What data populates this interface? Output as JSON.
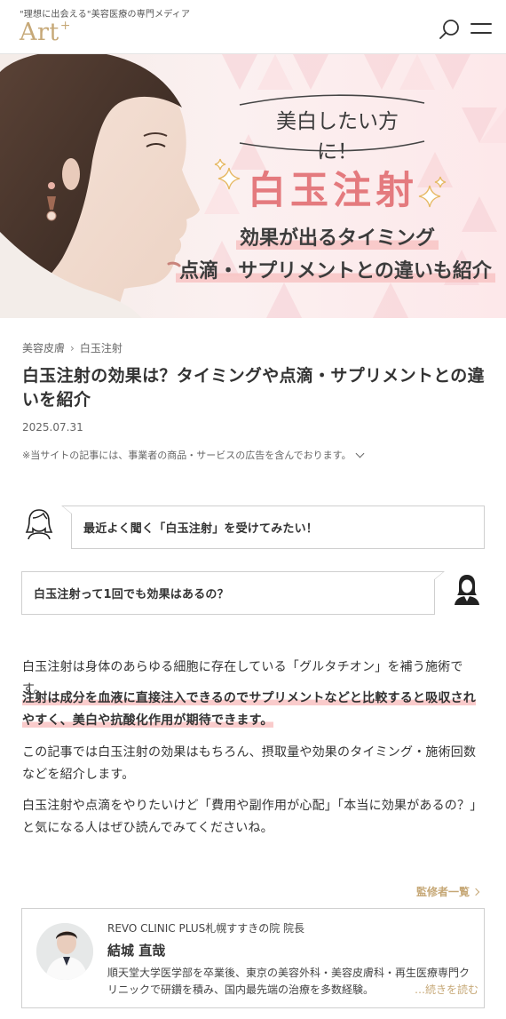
{
  "header": {
    "tagline": "\"理想に出会える\"美容医療の専門メディア",
    "logo": "Art",
    "logo_sup": "+",
    "icons": {
      "search": "search-icon",
      "menu": "hamburger-menu-icon"
    }
  },
  "hero": {
    "sub_heading": "美白したい方に！",
    "main_heading": "白玉注射",
    "line1": "効果が出るタイミング",
    "line2": "点滴・サプリメントとの違いも紹介"
  },
  "breadcrumb": {
    "category": "美容皮膚",
    "current": "白玉注射",
    "separator_icon": "chevron-right-icon"
  },
  "article": {
    "title": "白玉注射の効果は？タイミングや点滴・サプリメントとの違いを紹介",
    "date": "2025.07.31",
    "ad_note": "※当サイトの記事には、事業者の商品・サービスの広告を含んでおります。"
  },
  "dialogue": [
    {
      "speaker_icon": "woman-avatar-icon",
      "text": "最近よく聞く「白玉注射」を受けてみたい！"
    },
    {
      "speaker_icon": "consultant-avatar-icon",
      "text": "白玉注射って1回でも効果はあるの？"
    }
  ],
  "body": {
    "p1": "白玉注射は身体のあらゆる細胞に存在している「グルタチオン」を補う施術です。",
    "p2": "注射は成分を血液に直接注入できるのでサプリメントなどと比較すると吸収されやすく、美白や抗酸化作用が期待できます。",
    "p3": "この記事では白玉注射の効果はもちろん、摂取量や効果のタイミング・施術回数などを紹介します。",
    "p4": "白玉注射や点滴をやりたいけど「費用や副作用が心配」「本当に効果があるの？」と気になる人はぜひ読んでみてくださいね。"
  },
  "supervisor": {
    "list_link": "監修者一覧",
    "clinic": "REVO CLINIC PLUS札幌すすきの院 院長",
    "name": "結城 直哉",
    "description": "順天堂大学医学部を卒業後、東京の美容外科・美容皮膚科・再生医療専門クリニックで研鑽を積み、国内最先端の治療を多数経験。",
    "more": "…続きを読む"
  },
  "colors": {
    "accent_gold": "#c6a877",
    "hero_pink": "#e47a7e",
    "highlight_pink": "#f8bebe"
  }
}
